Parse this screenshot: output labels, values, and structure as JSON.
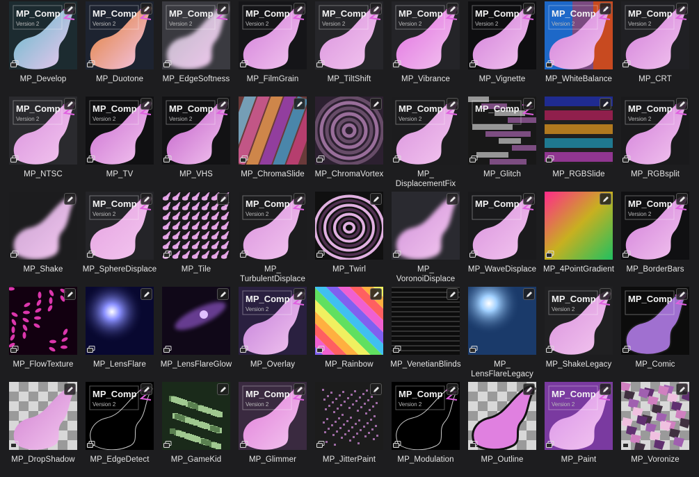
{
  "grid": {
    "rows": [
      [
        {
          "label": "MP_Develop",
          "style": "comp",
          "tint": "#5ab8c8",
          "bg": "#1c2b30",
          "badge": "MP_Comp",
          "sub": "Version 2"
        },
        {
          "label": "MP_Duotone",
          "style": "comp",
          "tint": "#e07a2a",
          "bg": "#1d2330",
          "badge": "MP_Comp",
          "sub": "Version 2"
        },
        {
          "label": "MP_EdgeSoftness",
          "style": "blur",
          "tint": "#b9b9c4",
          "bg": "#3a3a40",
          "badge": "MP_Comp",
          "sub": "Version 2"
        },
        {
          "label": "MP_FilmGrain",
          "style": "comp",
          "tint": "#d07ad8",
          "bg": "#151518",
          "badge": "MP_Comp",
          "sub": "Version 2"
        },
        {
          "label": "MP_TiltShift",
          "style": "comp",
          "tint": "#d88fdc",
          "bg": "#26262a",
          "badge": "MP_Comp",
          "sub": "Version 2"
        },
        {
          "label": "MP_Vibrance",
          "style": "comp",
          "tint": "#e06ae0",
          "bg": "#242428",
          "badge": "MP_Comp",
          "sub": "Version 2"
        },
        {
          "label": "MP_Vignette",
          "style": "comp",
          "tint": "#d07ad8",
          "bg": "#0e0e10",
          "badge": "MP_Comp",
          "sub": "Version 2"
        },
        {
          "label": "MP_WhiteBalance",
          "style": "split",
          "tint": "#d07ad8",
          "bg": "#1b4b8a",
          "badge": "MP_Comp",
          "sub": "Version 2"
        },
        {
          "label": "MP_CRT",
          "style": "comp",
          "tint": "#d07ad8",
          "bg": "#202024",
          "badge": "MP_Comp",
          "sub": "Version 2"
        }
      ],
      [
        {
          "label": "MP_NTSC",
          "style": "comp",
          "tint": "#d88fdc",
          "bg": "#2a2a2e",
          "badge": "MP_Comp",
          "sub": "Version 2"
        },
        {
          "label": "MP_TV",
          "style": "comp",
          "tint": "#c96ad0",
          "bg": "#101012",
          "badge": "MP_Comp",
          "sub": "Version 2"
        },
        {
          "label": "MP_VHS",
          "style": "comp",
          "tint": "#c05ac8",
          "bg": "#121214",
          "badge": "MP_Comp",
          "sub": "Version 2"
        },
        {
          "label": "MP_ChromaSlide",
          "style": "streak",
          "tint": "#c860c0",
          "bg": "#6a3a3a",
          "badge": "",
          "sub": ""
        },
        {
          "label": "MP_ChromaVortex",
          "style": "vortex",
          "tint": "#c080c0",
          "bg": "#2c2030",
          "badge": "",
          "sub": ""
        },
        {
          "label": "MP_\nDisplacementFix",
          "style": "comp",
          "tint": "#d88fdc",
          "bg": "#1c1c1e",
          "badge": "MP_Comp",
          "sub": "Version 2"
        },
        {
          "label": "MP_Glitch",
          "style": "glitch",
          "tint": "#d07ad8",
          "bg": "#181818",
          "badge": "MP_Comp",
          "sub": ""
        },
        {
          "label": "MP_RGBSlide",
          "style": "rgb",
          "tint": "#d070d0",
          "bg": "#202020",
          "badge": "",
          "sub": ""
        },
        {
          "label": "MP_RGBsplit",
          "style": "comp",
          "tint": "#d07ad8",
          "bg": "#1a1a1c",
          "badge": "MP_Comp",
          "sub": "Version 2"
        }
      ],
      [
        {
          "label": "MP_Shake",
          "style": "blur",
          "tint": "#c8a0d0",
          "bg": "#1c1c1e",
          "badge": "",
          "sub": ""
        },
        {
          "label": "MP_SphereDisplace",
          "style": "comp",
          "tint": "#e4a0e0",
          "bg": "#242428",
          "badge": "MP_Comp",
          "sub": "Version 2"
        },
        {
          "label": "MP_Tile",
          "style": "tile",
          "tint": "#d07ad8",
          "bg": "#1a1a1c",
          "badge": "",
          "sub": ""
        },
        {
          "label": "MP_\nTurbulentDisplace",
          "style": "comp",
          "tint": "#d88fdc",
          "bg": "#1c1c1e",
          "badge": "MP_Comp",
          "sub": "Version 2"
        },
        {
          "label": "MP_Twirl",
          "style": "twirl",
          "tint": "#d8a0d8",
          "bg": "#101010",
          "badge": "",
          "sub": ""
        },
        {
          "label": "MP_\nVoronoiDisplace",
          "style": "blur",
          "tint": "#d090d8",
          "bg": "#2a2a30",
          "badge": "",
          "sub": ""
        },
        {
          "label": "MP_WaveDisplace",
          "style": "comp",
          "tint": "#d88fdc",
          "bg": "#1a1a1c",
          "badge": "MP_Comp",
          "sub": ""
        },
        {
          "label": "MP_4PointGradient",
          "style": "gradient4",
          "tint": "#ff2a8a",
          "bg": "#30c040",
          "badge": "",
          "sub": ""
        },
        {
          "label": "MP_BorderBars",
          "style": "comp",
          "tint": "#d07ad8",
          "bg": "#101012",
          "badge": "MP_Comp",
          "sub": "Version 2"
        }
      ],
      [
        {
          "label": "MP_FlowTexture",
          "style": "flow",
          "tint": "#ff40c0",
          "bg": "#120010",
          "badge": "",
          "sub": ""
        },
        {
          "label": "MP_LensFlare",
          "style": "flare",
          "tint": "#6a70ff",
          "bg": "#080830",
          "badge": "",
          "sub": ""
        },
        {
          "label": "MP_LensFlareGlow",
          "style": "flareglow",
          "tint": "#a060e0",
          "bg": "#100818",
          "badge": "",
          "sub": ""
        },
        {
          "label": "MP_Overlay",
          "style": "comp",
          "tint": "#c07ad8",
          "bg": "#2a2040",
          "badge": "MP_Comp",
          "sub": "Version 2"
        },
        {
          "label": "MP_Rainbow",
          "style": "rainbow",
          "tint": "#ffffff",
          "bg": "#ffffff",
          "badge": "",
          "sub": ""
        },
        {
          "label": "MP_VenetianBlinds",
          "style": "blinds",
          "tint": "#d070d0",
          "bg": "#0c0c0c",
          "badge": "",
          "sub": ""
        },
        {
          "label": "MP_\nLensFlareLegacy",
          "style": "flarelegacy",
          "tint": "#ffffff",
          "bg": "#1a3a6a",
          "badge": "",
          "sub": ""
        },
        {
          "label": "MP_ShakeLegacy",
          "style": "comp",
          "tint": "#d88fdc",
          "bg": "#202022",
          "badge": "MP_Comp",
          "sub": "Version 2"
        },
        {
          "label": "MP_Comic",
          "style": "comic",
          "tint": "#b070d0",
          "bg": "#0c0c0c",
          "badge": "MP_Comp",
          "sub": ""
        }
      ],
      [
        {
          "label": "MP_DropShadow",
          "style": "checker",
          "tint": "#d080d0",
          "bg": "#aaaaaa",
          "badge": "",
          "sub": ""
        },
        {
          "label": "MP_EdgeDetect",
          "style": "edge",
          "tint": "#888888",
          "bg": "#000000",
          "badge": "MP_Comp",
          "sub": "Version 2"
        },
        {
          "label": "MP_GameKid",
          "style": "gamekid",
          "tint": "#a0c890",
          "bg": "#1a2a1a",
          "badge": "",
          "sub": ""
        },
        {
          "label": "MP_Glimmer",
          "style": "comp",
          "tint": "#e07ad8",
          "bg": "#3a2a40",
          "badge": "MP_Comp",
          "sub": "Version 2"
        },
        {
          "label": "MP_JitterPaint",
          "style": "jitter",
          "tint": "#c080c8",
          "bg": "#1c1c1c",
          "badge": "",
          "sub": ""
        },
        {
          "label": "MP_Modulation",
          "style": "edge",
          "tint": "#aaaaaa",
          "bg": "#000000",
          "badge": "MP_Comp",
          "sub": "Version 2"
        },
        {
          "label": "MP_Outline",
          "style": "outline",
          "tint": "#d070d0",
          "bg": "#aaaaaa",
          "badge": "",
          "sub": ""
        },
        {
          "label": "MP_Paint",
          "style": "comp",
          "tint": "#d890e8",
          "bg": "#7a3aa0",
          "badge": "MP_Comp",
          "sub": "Version 2"
        },
        {
          "label": "MP_Voronize",
          "style": "voronize",
          "tint": "#d080c0",
          "bg": "#aaaaaa",
          "badge": "",
          "sub": ""
        }
      ]
    ]
  },
  "icons": {
    "edit": "pencil-edit-icon",
    "stack": "stack-icon"
  }
}
